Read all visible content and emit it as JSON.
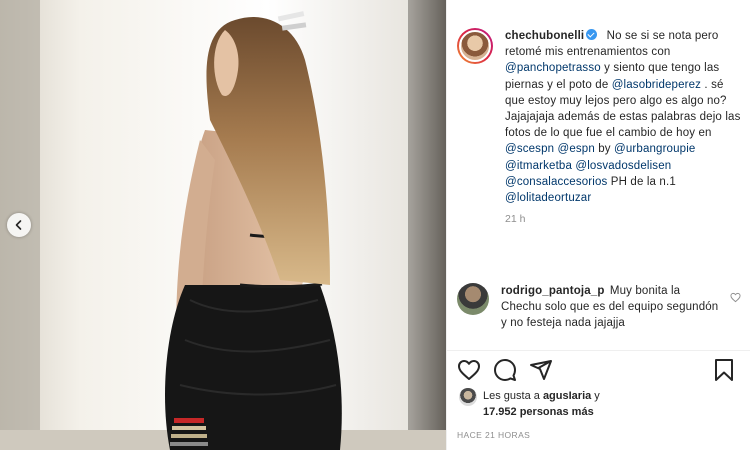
{
  "post": {
    "username": "chechubonelli",
    "caption_segments": [
      {
        "t": " No se si se nota pero retomé mis entrenamientos con ",
        "m": false
      },
      {
        "t": "@panchopetrasso",
        "m": true
      },
      {
        "t": " y siento que tengo las piernas y el poto de ",
        "m": false
      },
      {
        "t": "@lasobrideperez",
        "m": true
      },
      {
        "t": " . sé que estoy muy lejos pero algo es algo no? Jajajajaja además de estas palabras dejo las fotos de lo que fue el cambio de hoy en ",
        "m": false
      },
      {
        "t": "@scespn",
        "m": true
      },
      {
        "t": " ",
        "m": false
      },
      {
        "t": "@espn",
        "m": true
      },
      {
        "t": " by ",
        "m": false
      },
      {
        "t": "@urbangroupie",
        "m": true
      },
      {
        "t": " ",
        "m": false
      },
      {
        "t": "@itmarketba",
        "m": true
      },
      {
        "t": " ",
        "m": false
      },
      {
        "t": "@losvadosdelisen",
        "m": true
      },
      {
        "t": " ",
        "m": false
      },
      {
        "t": "@consalaccesorios",
        "m": true
      },
      {
        "t": " PH de la n.1 ",
        "m": false
      },
      {
        "t": "@lolitadeortuzar",
        "m": true
      }
    ],
    "time": "21 h"
  },
  "comment": {
    "username": "rodrigo_pantoja_p",
    "text": " Muy bonita la Chechu solo que es del equipo segundón y no festeja nada jajajja"
  },
  "likes": {
    "prefix": "Les gusta a ",
    "user": "agusIaria",
    "suffix": " y",
    "count": "17.952 personas más"
  },
  "timestamp": "HACE 21 HORAS",
  "icons": {
    "like": "heart-icon",
    "comment": "comment-icon",
    "share": "share-icon",
    "save": "bookmark-icon",
    "prev": "chevron-left-icon",
    "verified": "verified-badge-icon"
  },
  "colors": {
    "link": "#00376b",
    "verified": "#3897f0",
    "muted": "#8e8e8e",
    "text": "#262626"
  }
}
